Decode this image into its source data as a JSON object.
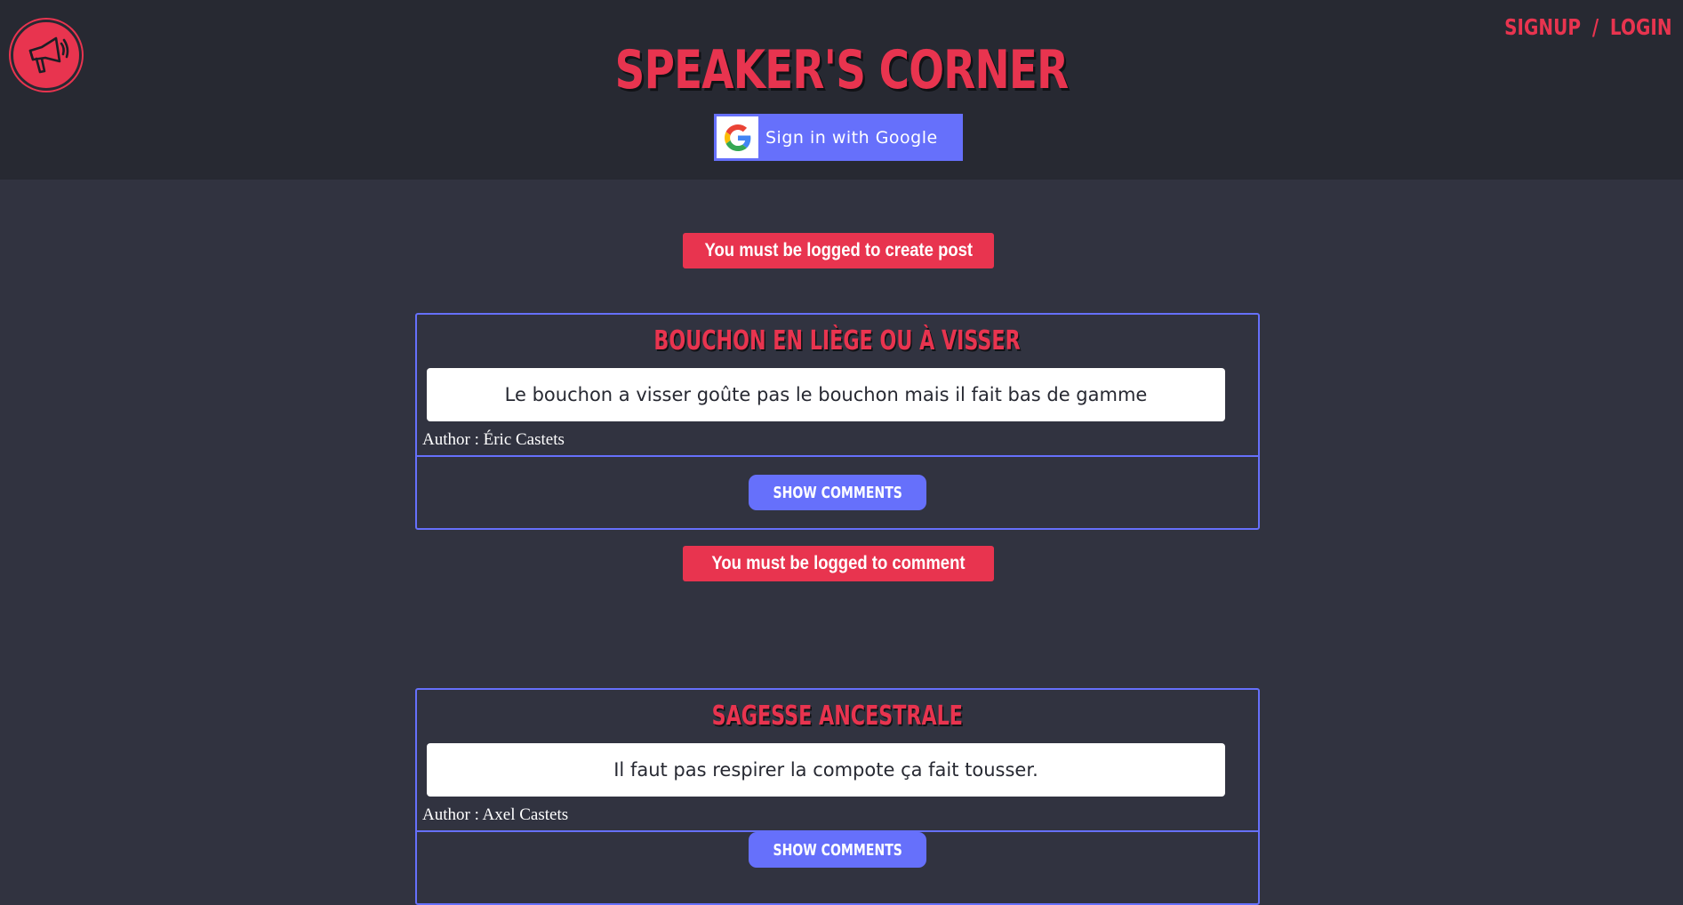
{
  "header": {
    "title": "SPEAKER'S CORNER",
    "logo_icon": "megaphone-icon",
    "signup_label": "SIGNUP",
    "separator": "/",
    "login_label": "LOGIN",
    "google_button_label": "Sign in with Google",
    "google_icon": "google-icon"
  },
  "notices": {
    "create_post": "You must be logged to create post",
    "comment": "You must be logged to comment"
  },
  "posts": [
    {
      "title": "BOUCHON EN LIÈGE OU À VISSER",
      "body": "Le bouchon a visser goûte pas le bouchon mais il fait bas de gamme",
      "author": "Author : Éric Castets",
      "show_comments_label": "SHOW COMMENTS"
    },
    {
      "title": "SAGESSE ANCESTRALE",
      "body": "Il faut pas respirer la compote ça fait tousser.",
      "author": "Author : Axel Castets",
      "show_comments_label": "SHOW COMMENTS"
    }
  ],
  "colors": {
    "background": "#313340",
    "header_background": "#272932",
    "accent_red": "#e8344f",
    "accent_blue": "#6670fb"
  }
}
